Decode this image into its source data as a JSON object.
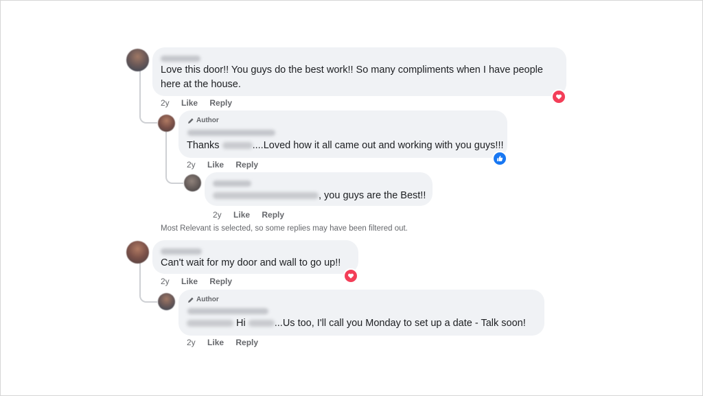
{
  "comments": [
    {
      "text": "Love this door!! You guys do the best work!! So many compliments when I have people",
      "text_line2": "here at the house.",
      "time": "2y",
      "like": "Like",
      "reply": "Reply",
      "reaction": "love",
      "replies": [
        {
          "badge": "Author",
          "text_before": "Thanks ",
          "text_after": "....Loved how it all came out and working with you guys!!!",
          "time": "2y",
          "like": "Like",
          "reply": "Reply",
          "reaction": "like"
        },
        {
          "text_after": ", you guys are the Best!!",
          "time": "2y",
          "like": "Like",
          "reply": "Reply"
        }
      ]
    },
    {
      "text": "Can't wait for my door and wall to go up!!",
      "time": "2y",
      "like": "Like",
      "reply": "Reply",
      "reaction": "love",
      "replies": [
        {
          "badge": "Author",
          "text_mid": " Hi ",
          "text_after": "...Us too, I'll call you Monday to set up a date - Talk soon!",
          "time": "2y",
          "like": "Like",
          "reply": "Reply"
        }
      ]
    }
  ],
  "filter_note": "Most Relevant is selected, so some replies may have been filtered out.",
  "colors": {
    "love": "#f33e58",
    "like": "#1877f2",
    "bubble": "#f0f2f5"
  }
}
